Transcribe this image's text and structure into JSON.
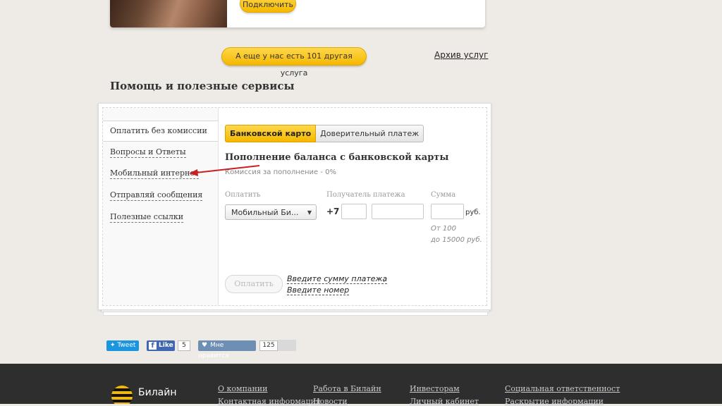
{
  "promo": {
    "connect_label": "Подключить"
  },
  "more_services_label": "А еще у нас есть 101 другая услуга",
  "archive_label": "Архив услуг",
  "section_title": "Помощь и полезные сервисы",
  "sidebar": {
    "items": [
      {
        "label": "Оплатить без комиссии"
      },
      {
        "label": "Вопросы и Ответы"
      },
      {
        "label": "Мобильный интернет"
      },
      {
        "label": "Отправляй сообщения"
      },
      {
        "label": "Полезные ссылки"
      }
    ]
  },
  "tabs": {
    "card": "Банковской карто",
    "trust": "Доверительный платеж"
  },
  "form": {
    "title": "Пополнение баланса с банковской карты",
    "subtitle": "Комиссия за пополнение - 0%",
    "pay_label": "Оплатить",
    "recipient_label": "Получатель платежа",
    "sum_label": "Сумма",
    "select_value": "Мобильный Би...",
    "prefix": "+7",
    "currency": "руб.",
    "min_hint": "От 100",
    "max_hint": "до 15000 руб.",
    "submit_label": "Оплатить",
    "error_sum": "Введите сумму платежа",
    "comma": ",",
    "error_number": "Введите номер"
  },
  "social": {
    "tweet": "Tweet",
    "fb_like": "Like",
    "fb_count": "5",
    "vk_like": "Мне нравится",
    "vk_count": "125"
  },
  "footer": {
    "brand": "Билайн",
    "row1": [
      "О компании",
      "Работа в Билайн",
      "Инвесторам",
      "Социальная ответственност"
    ],
    "row2": [
      "Контактная информация",
      "Новости",
      "Личный кабинет",
      "Раскрытие информации"
    ]
  },
  "colors": {
    "accent": "#f5b800",
    "footer_bg": "#2e2e2e",
    "arrow": "#cc1f1f"
  }
}
